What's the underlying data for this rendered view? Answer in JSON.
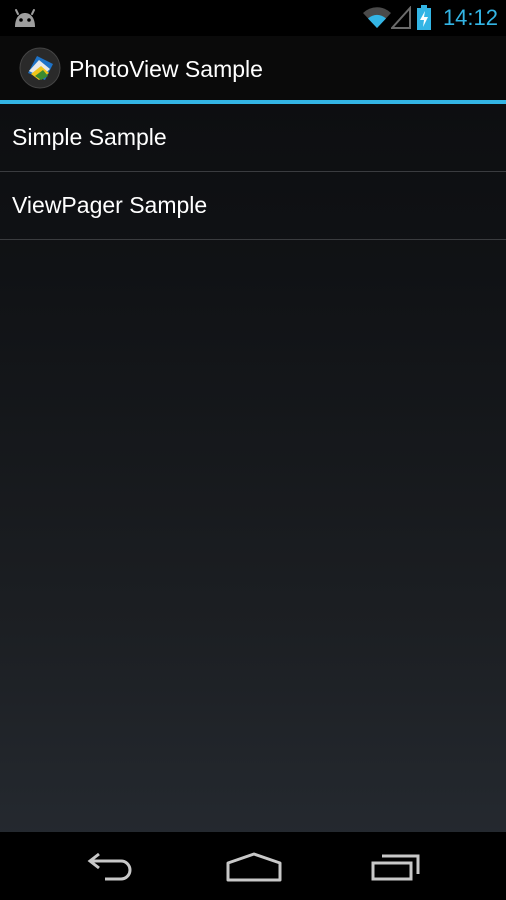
{
  "status_bar": {
    "time": "14:12",
    "accent_color": "#33b5e5",
    "icons": [
      "android-notification-icon",
      "wifi-icon",
      "signal-icon",
      "battery-charging-icon"
    ]
  },
  "action_bar": {
    "title": "PhotoView Sample",
    "icon": "photoview-app-icon",
    "divider_color": "#33b5e5"
  },
  "list": {
    "items": [
      {
        "label": "Simple Sample"
      },
      {
        "label": "ViewPager Sample"
      }
    ]
  },
  "nav_bar": {
    "buttons": [
      "back-icon",
      "home-icon",
      "recent-apps-icon"
    ]
  }
}
